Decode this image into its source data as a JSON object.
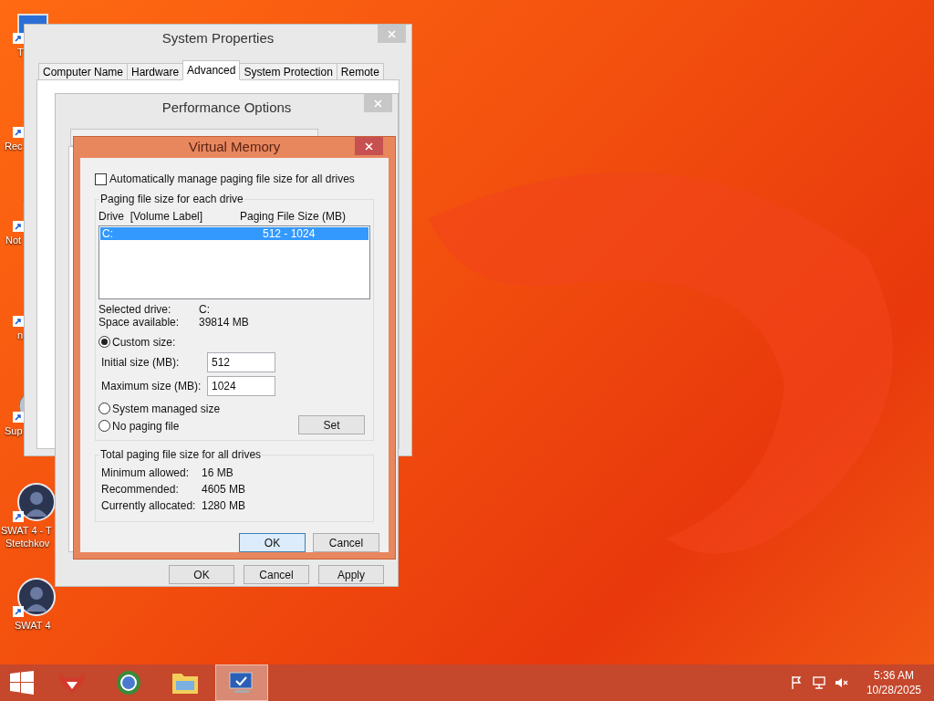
{
  "desktop_icons": [
    {
      "kind": "computer",
      "lines": [
        "T"
      ]
    },
    {
      "kind": "recycle",
      "lines": [
        "Rec"
      ]
    },
    {
      "kind": "notepad",
      "lines": [
        "Not"
      ]
    },
    {
      "kind": "media",
      "lines": [
        "n"
      ]
    },
    {
      "kind": "globe",
      "lines": [
        "Sup"
      ]
    },
    {
      "kind": "game",
      "lines": [
        "SWAT 4 - T",
        "Stetchkov"
      ]
    },
    {
      "kind": "game",
      "lines": [
        "SWAT 4"
      ]
    }
  ],
  "system_properties": {
    "title": "System Properties",
    "tabs": [
      {
        "label": "Computer Name",
        "selected": false
      },
      {
        "label": "Hardware",
        "selected": false
      },
      {
        "label": "Advanced",
        "selected": true
      },
      {
        "label": "System Protection",
        "selected": false
      },
      {
        "label": "Remote",
        "selected": false
      }
    ]
  },
  "performance_options": {
    "title": "Performance Options",
    "buttons": [
      "OK",
      "Cancel",
      "Apply"
    ]
  },
  "virtual_memory": {
    "title": "Virtual Memory",
    "auto_manage": {
      "label": "Automatically manage paging file size for all drives",
      "checked": false
    },
    "paging_group": {
      "title": "Paging file size for each drive",
      "columns": [
        "Drive  [Volume Label]",
        "Paging File Size (MB)"
      ],
      "drives": [
        {
          "drive": "C:",
          "size": "512 - 1024",
          "selected": true
        }
      ],
      "selected_drive": {
        "label": "Selected drive:",
        "value": "C:"
      },
      "space_available": {
        "label": "Space available:",
        "value": "39814 MB"
      },
      "options": [
        {
          "label": "Custom size:",
          "selected": true
        },
        {
          "label": "System managed size",
          "selected": false
        },
        {
          "label": "No paging file",
          "selected": false
        }
      ],
      "initial_size": {
        "label": "Initial size (MB):",
        "value": "512"
      },
      "maximum_size": {
        "label": "Maximum size (MB):",
        "value": "1024"
      },
      "set_button": "Set"
    },
    "totals": {
      "title": "Total paging file size for all drives",
      "rows": [
        {
          "label": "Minimum allowed:",
          "value": "16 MB"
        },
        {
          "label": "Recommended:",
          "value": "4605 MB"
        },
        {
          "label": "Currently allocated:",
          "value": "1280 MB"
        }
      ]
    },
    "buttons": [
      {
        "label": "OK",
        "default": true
      },
      {
        "label": "Cancel",
        "default": false
      }
    ]
  },
  "taskbar": {
    "apps": [
      {
        "kind": "game",
        "active": false
      },
      {
        "kind": "browser",
        "active": false
      },
      {
        "kind": "folder",
        "active": false
      },
      {
        "kind": "system",
        "active": true
      }
    ],
    "clock": {
      "time": "5:36 AM",
      "date": "10/28/2025"
    }
  }
}
